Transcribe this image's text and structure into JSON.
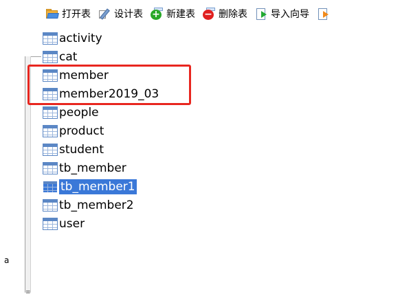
{
  "left_pane": {
    "partial_text": "a",
    "splitter_grip": "≡"
  },
  "toolbar": {
    "open_table": "打开表",
    "design_table": "设计表",
    "new_table": "新建表",
    "delete_table": "删除表",
    "import_wizard": "导入向导"
  },
  "tables": [
    {
      "name": "activity"
    },
    {
      "name": "cat"
    },
    {
      "name": "member"
    },
    {
      "name": "member2019_03"
    },
    {
      "name": "people"
    },
    {
      "name": "product"
    },
    {
      "name": "student"
    },
    {
      "name": "tb_member"
    },
    {
      "name": "tb_member1",
      "selected": true
    },
    {
      "name": "tb_member2"
    },
    {
      "name": "user"
    }
  ],
  "colors": {
    "selection": "#3a78d8",
    "highlight_box": "#e8261f",
    "new_icon": "#28a828",
    "delete_icon": "#e02020"
  }
}
